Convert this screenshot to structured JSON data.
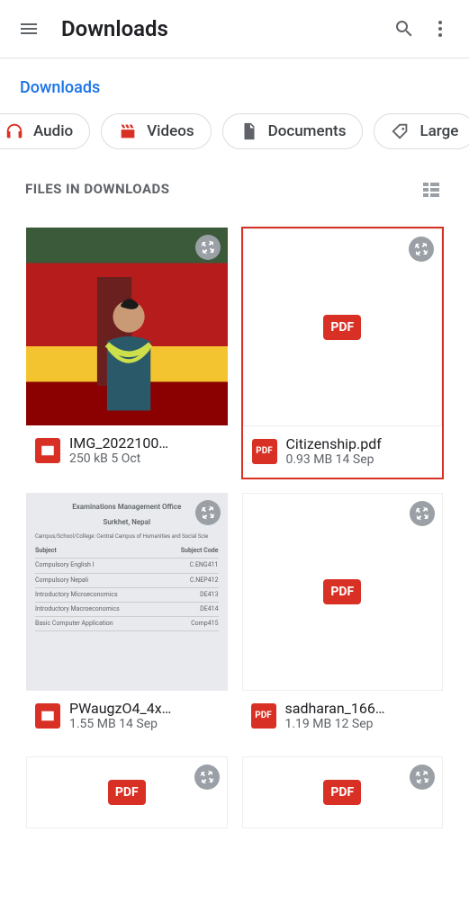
{
  "topbar": {
    "title": "Downloads"
  },
  "breadcrumb": {
    "label": "Downloads"
  },
  "chips": {
    "audio": "Audio",
    "videos": "Videos",
    "documents": "Documents",
    "large": "Large"
  },
  "section": {
    "label": "FILES IN DOWNLOADS"
  },
  "files": [
    {
      "name": "IMG_2022100…",
      "info": "250 kB 5 Oct",
      "type": "img",
      "highlight": false
    },
    {
      "name": "Citizenship.pdf",
      "info": "0.93 MB 14 Sep",
      "type": "pdf",
      "highlight": true
    },
    {
      "name": "PWaugzO4_4x…",
      "info": "1.55 MB 14 Sep",
      "type": "img",
      "highlight": false
    },
    {
      "name": "sadharan_166…",
      "info": "1.19 MB 12 Sep",
      "type": "pdf",
      "highlight": false
    }
  ],
  "doc_preview": {
    "title1": "Examinations Management Office",
    "title2": "Surkhet, Nepal",
    "col1": "Subject",
    "col2": "Subject Code",
    "r1a": "Compulsory English I",
    "r1b": "C.ENG411",
    "r2a": "Compulsory Nepali",
    "r2b": "C.NEP412",
    "r3a": "Introductory Microeconomics",
    "r3b": "DE413",
    "r4a": "Introductory Macroeconomics",
    "r4b": "DE414",
    "r5a": "Basic Computer Application",
    "r5b": "Comp415",
    "campus": "Campus/School/College: Central Campus of Humanities and Social Scie"
  },
  "pdf_label": "PDF"
}
